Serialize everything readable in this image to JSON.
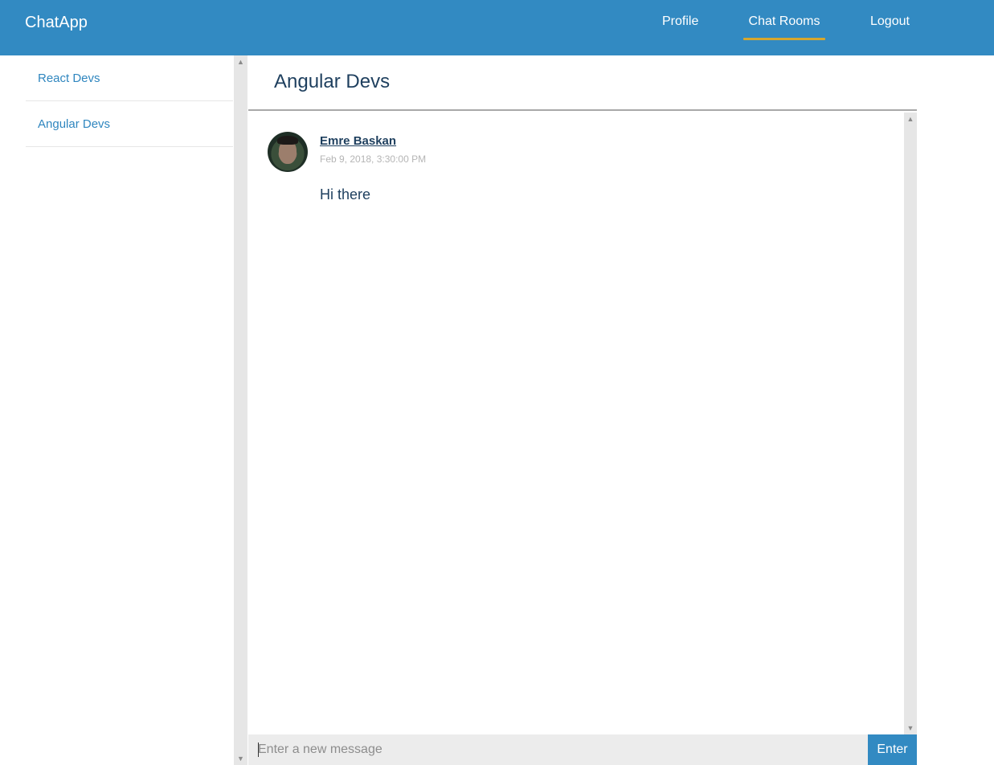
{
  "navbar": {
    "brand": "ChatApp",
    "links": [
      "Profile",
      "Chat Rooms",
      "Logout"
    ],
    "active_link": "Chat Rooms",
    "background_color": "#328ac2",
    "active_underline_color": "#d5a72e"
  },
  "sidebar": {
    "rooms": [
      {
        "label": "React Devs"
      },
      {
        "label": "Angular Devs"
      }
    ]
  },
  "room": {
    "title": "Angular Devs",
    "messages": [
      {
        "author": "Emre Baskan",
        "timestamp": "Feb 9, 2018, 3:30:00 PM",
        "text": "Hi there"
      }
    ]
  },
  "composer": {
    "placeholder": "Enter a new message",
    "button_label": "Enter"
  },
  "icons": {
    "scroll_up": "▲",
    "scroll_down": "▼"
  }
}
